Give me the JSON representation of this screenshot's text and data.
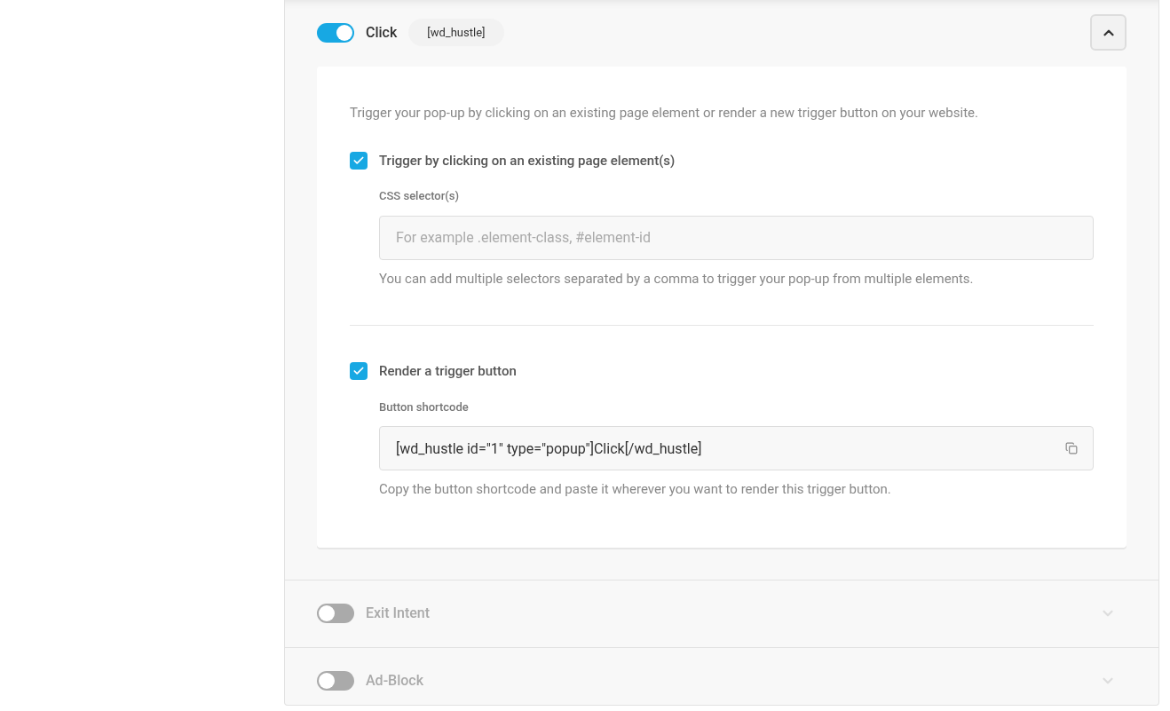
{
  "triggers": [
    {
      "label": "Click",
      "on": true,
      "expanded": true,
      "tag": "[wd_hustle]",
      "settings": {
        "description": "Trigger your pop-up by clicking on an existing page element or render a new trigger button on your website.",
        "options": [
          {
            "label": "Trigger by clicking on an existing page element(s)",
            "checked": true,
            "field_label": "CSS selector(s)",
            "placeholder": "For example .element-class, #element-id",
            "help": "You can add multiple selectors separated by a comma to trigger your pop-up from multiple elements."
          },
          {
            "label": "Render a trigger button",
            "checked": true,
            "field_label": "Button shortcode",
            "value": "[wd_hustle id=\"1\" type=\"popup\"]Click[/wd_hustle]",
            "copy": true,
            "help": "Copy the button shortcode and paste it wherever you want to render this trigger button."
          }
        ]
      }
    },
    {
      "label": "Exit Intent",
      "on": false,
      "expanded": false
    },
    {
      "label": "Ad-Block",
      "on": false,
      "expanded": false
    }
  ]
}
